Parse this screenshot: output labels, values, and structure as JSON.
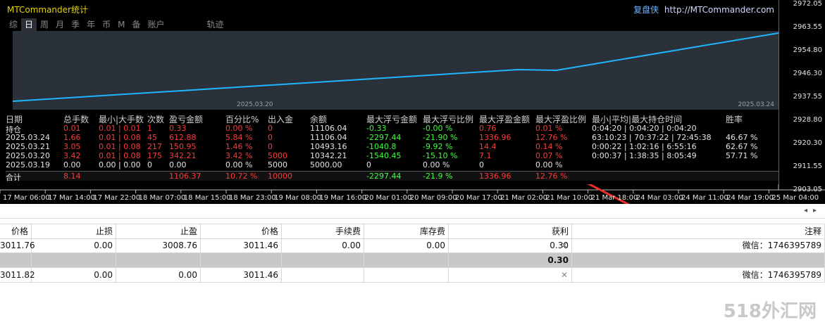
{
  "panel": {
    "title": "MTCommander统计",
    "brand_cn": "复盘侠",
    "brand_url": "http://MTCommander.com"
  },
  "tabs": [
    "综",
    "日",
    "周",
    "月",
    "季",
    "年",
    "币",
    "M",
    "备",
    "账户",
    "轨迹"
  ],
  "active_tab": "日",
  "graph_dates": {
    "left": "2025.03.20",
    "right": "2025.03.24"
  },
  "stats": {
    "headers": [
      "日期",
      "总手数",
      "最小|大手数",
      "次数",
      "盈亏金额",
      "百分比%",
      "出入金",
      "余额",
      "最大浮亏金额",
      "最大浮亏比例",
      "最大浮盈金额",
      "最大浮盈比例",
      "最小|平均|最大持仓时间",
      "胜率"
    ],
    "rows": [
      [
        "持仓",
        "0.01",
        "0.01 | 0.01",
        "1",
        "0.33",
        "0.00 %",
        "0",
        "11106.04",
        "-0.33",
        "-0.00 %",
        "0.76",
        "0.01 %",
        "0:04:20 | 0:04:20 | 0:04:20",
        ""
      ],
      [
        "2025.03.24",
        "1.66",
        "0.01 | 0.08",
        "45",
        "612.88",
        "5.84 %",
        "0",
        "11106.04",
        "-2297.44",
        "-21.90 %",
        "1336.96",
        "12.76 %",
        "63:10:23 | 70:37:22 | 72:45:38",
        "46.67 %"
      ],
      [
        "2025.03.21",
        "3.05",
        "0.01 | 0.08",
        "217",
        "150.95",
        "1.46 %",
        "0",
        "10493.16",
        "-1040.8",
        "-9.92 %",
        "14.4",
        "0.14 %",
        "0:00:22 | 1:02:16 | 6:55:16",
        "62.67 %"
      ],
      [
        "2025.03.20",
        "3.42",
        "0.01 | 0.08",
        "175",
        "342.21",
        "3.42 %",
        "5000",
        "10342.21",
        "-1540.45",
        "-15.10 %",
        "7.1",
        "0.07 %",
        "0:00:37 | 1:38:35 | 8:05:49",
        "57.71 %"
      ],
      [
        "2025.03.19",
        "0.00",
        "0.00 | 0.00",
        "0",
        "0.00",
        "0.00 %",
        "5000",
        "5000.00",
        "0",
        "0.00 %",
        "0",
        "0.00 %",
        "",
        ""
      ],
      [
        "合计",
        "8.14",
        "",
        "",
        "1106.37",
        "10.72 %",
        "10000",
        "",
        "-2297.44",
        "-21.9 %",
        "1336.96",
        "12.76 %",
        "",
        ""
      ]
    ]
  },
  "y_axis": [
    "2972.05",
    "2963.55",
    "2954.80",
    "2946.30",
    "2937.55",
    "2928.80",
    "2920.30",
    "2911.55",
    "2903.05"
  ],
  "x_axis": [
    "17 Mar 06:00",
    "17 Mar 14:00",
    "17 Mar 22:00",
    "18 Mar 07:00",
    "18 Mar 15:00",
    "18 Mar 23:00",
    "19 Mar 08:00",
    "19 Mar 16:00",
    "20 Mar 01:00",
    "20 Mar 09:00",
    "20 Mar 17:00",
    "21 Mar 02:00",
    "21 Mar 10:00",
    "21 Mar 18:00",
    "24 Mar 03:00",
    "24 Mar 11:00",
    "24 Mar 19:00",
    "25 Mar 04:00"
  ],
  "chart_data": {
    "type": "line",
    "title": "",
    "xlabel": "",
    "ylabel": "",
    "x": [
      "2025.03.19",
      "2025.03.20",
      "2025.03.21",
      "2025.03.24"
    ],
    "series": [
      {
        "values": [
          5000.0,
          10342.21,
          10493.16,
          11106.04
        ]
      }
    ],
    "line_color": "#1fb6ff",
    "grid": false
  },
  "grid": {
    "headers": [
      "价格",
      "止损",
      "止盈",
      "价格",
      "手续费",
      "库存费",
      "获利",
      "注释"
    ],
    "rows": [
      [
        "3011.76",
        "0.00",
        "3008.76",
        "3011.46",
        "0.00",
        "0.00",
        "0.30",
        "微信：1746395789"
      ],
      [
        "3011.82",
        "0.00",
        "0.00",
        "3011.46",
        "",
        "",
        "",
        "微信：1746395789"
      ]
    ],
    "summary_profit": "0.30"
  },
  "watermark": "518外汇网",
  "colors": {
    "graph_bg": "#2b3138",
    "red": "#ff3a3a",
    "green": "#40ff40",
    "title": "#e6d400"
  }
}
